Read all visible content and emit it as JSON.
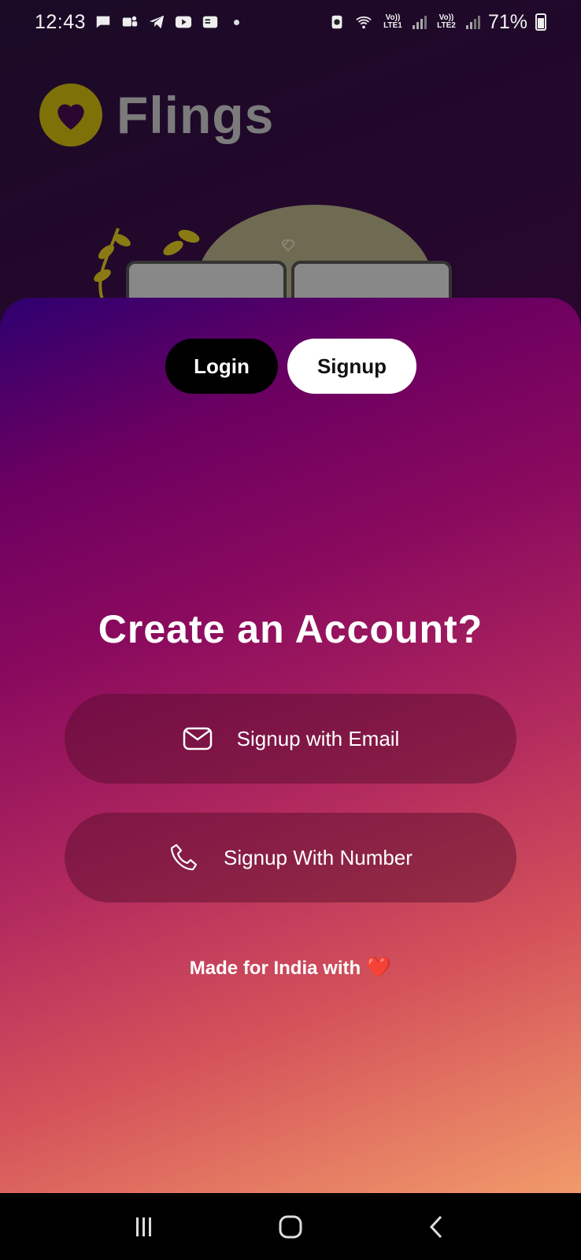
{
  "status_bar": {
    "time": "12:43",
    "battery_percent": "71%",
    "sim1_label": "Vo)) LTE1",
    "sim2_label": "Vo)) LTE2",
    "notification_icons": [
      "chat-icon",
      "teams-icon",
      "telegram-icon",
      "youtube-icon",
      "news-icon"
    ]
  },
  "app": {
    "name": "Flings",
    "brand_color": "#7e7108"
  },
  "auth": {
    "tabs": [
      {
        "label": "Login"
      },
      {
        "label": "Signup"
      }
    ],
    "selected_tab": "Signup",
    "headline": "Create an Account?",
    "email_button": "Signup with Email",
    "phone_button": "Signup With Number",
    "footer": "Made for India with",
    "footer_emoji": "❤️"
  },
  "nav": {
    "buttons": [
      "recents-icon",
      "home-icon",
      "back-icon"
    ]
  }
}
